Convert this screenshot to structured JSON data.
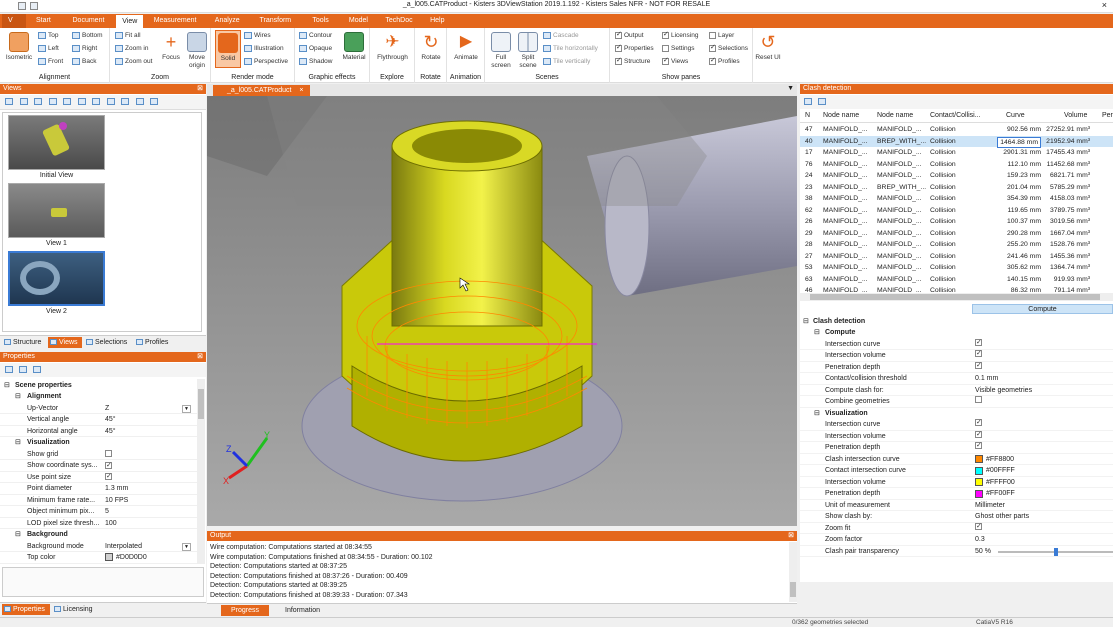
{
  "window": {
    "title": "_a_l005.CATProduct - Kisters 3DViewStation 2019.1.192 - Kisters Sales NFR - NOT FOR RESALE",
    "close_glyph": "×"
  },
  "menu": {
    "app_button": "V",
    "items": [
      "Start",
      "Document",
      "View",
      "Measurement",
      "Analyze",
      "Transform",
      "Tools",
      "Model",
      "TechDoc",
      "Help"
    ],
    "active": "View"
  },
  "ribbon": {
    "alignment": {
      "label": "Alignment",
      "isometric": "Isometric",
      "top": "Top",
      "bottom": "Bottom",
      "left": "Left",
      "right": "Right",
      "front": "Front",
      "back": "Back"
    },
    "zoom": {
      "label": "Zoom",
      "fit_all": "Fit all",
      "zoom_in": "Zoom in",
      "zoom_out": "Zoom out",
      "focus": "Focus",
      "move_origin": "Move origin"
    },
    "render_mode": {
      "label": "Render mode",
      "solid": "Solid",
      "wires": "Wires",
      "illustration": "Illustration",
      "perspective": "Perspective"
    },
    "graphic_effects": {
      "label": "Graphic effects",
      "contour": "Contour",
      "opaque": "Opaque",
      "shadow": "Shadow",
      "material": "Material"
    },
    "explore": {
      "label": "Explore",
      "flythrough": "Flythrough"
    },
    "rotate": {
      "label": "Rotate",
      "rotate": "Rotate"
    },
    "animation": {
      "label": "Animation",
      "animate": "Animate"
    },
    "scenes": {
      "label": "Scenes",
      "full_screen": "Full screen",
      "split_scene": "Split scene",
      "cascade": "Cascade",
      "tile_h": "Tile horizontally",
      "tile_v": "Tile vertically"
    },
    "show_panes": {
      "label": "Show panes",
      "items": [
        {
          "label": "Output",
          "checked": true
        },
        {
          "label": "Properties",
          "checked": true
        },
        {
          "label": "Structure",
          "checked": true
        },
        {
          "label": "Licensing",
          "checked": true
        },
        {
          "label": "Settings",
          "checked": false
        },
        {
          "label": "Views",
          "checked": true
        },
        {
          "label": "Layer",
          "checked": false
        },
        {
          "label": "Selections",
          "checked": true
        },
        {
          "label": "Profiles",
          "checked": true
        }
      ]
    },
    "reset_ui": "Reset UI"
  },
  "views_panel": {
    "title": "Views",
    "thumbnails": [
      "Initial View",
      "View 1",
      "View 2"
    ],
    "tabs": [
      "Structure",
      "Views",
      "Selections",
      "Profiles"
    ],
    "active_tab": "Views"
  },
  "properties_panel": {
    "title": "Properties",
    "section": "Scene properties",
    "rows": [
      {
        "type": "cat",
        "key": "Alignment"
      },
      {
        "type": "row",
        "key": "Up-Vector",
        "value": "Z"
      },
      {
        "type": "row",
        "key": "Vertical angle",
        "value": "45°"
      },
      {
        "type": "row",
        "key": "Horizontal angle",
        "value": "45°"
      },
      {
        "type": "cat",
        "key": "Visualization"
      },
      {
        "type": "check",
        "key": "Show grid",
        "checked": false
      },
      {
        "type": "check",
        "key": "Show coordinate sys...",
        "checked": true
      },
      {
        "type": "check",
        "key": "Use point size",
        "checked": true
      },
      {
        "type": "row",
        "key": "Point diameter",
        "value": "1.3 mm"
      },
      {
        "type": "row",
        "key": "Minimum frame rate...",
        "value": "10 FPS"
      },
      {
        "type": "row",
        "key": "Object minimum pix...",
        "value": "5"
      },
      {
        "type": "row",
        "key": "LOD pixel size thresh...",
        "value": "100"
      },
      {
        "type": "cat",
        "key": "Background"
      },
      {
        "type": "row",
        "key": "Background mode",
        "value": "Interpolated"
      },
      {
        "type": "color",
        "key": "Top color",
        "value": "#D0D0D0"
      }
    ],
    "tabs": [
      "Properties",
      "Licensing"
    ],
    "active_tab": "Properties"
  },
  "document_tab": {
    "label": "_a_l005.CATProduct",
    "close": "×"
  },
  "colors": {
    "accent": "#e4671c",
    "clash_curve": "#FF8800",
    "contact_curve": "#00FFFF",
    "volume": "#FFFF00",
    "depth": "#FF00FF"
  },
  "output_panel": {
    "title": "Output",
    "lines": [
      "Wire computation: Computations started at 08:34:55",
      "Wire computation: Computations finished at 08:34:55 - Duration: 00.102",
      "Detection: Computations started at 08:37:25",
      "Detection: Computations finished at 08:37:26 - Duration: 00.409",
      "Detection: Computations started at 08:39:25",
      "Detection: Computations finished at 08:39:33 - Duration: 07.343"
    ],
    "tabs": [
      "Progress",
      "Information"
    ],
    "active_tab": "Progress"
  },
  "clash_panel": {
    "title": "Clash detection",
    "headers": [
      "N",
      "Node name",
      "Node name",
      "Contact/Collisi...",
      "Curve",
      "Volume",
      "Per"
    ],
    "rows": [
      [
        "47",
        "MANIFOLD_...",
        "MANIFOLD_...",
        "Collision",
        "902.56 mm",
        "27252.91 mm³"
      ],
      [
        "40",
        "MANIFOLD_...",
        "BREP_WITH_...",
        "Collision",
        "1464.88 mm",
        "21952.94 mm³"
      ],
      [
        "17",
        "MANIFOLD_...",
        "MANIFOLD_...",
        "Collision",
        "2901.31 mm",
        "17455.43 mm³"
      ],
      [
        "76",
        "MANIFOLD_...",
        "MANIFOLD_...",
        "Collision",
        "112.10 mm",
        "11452.68 mm³"
      ],
      [
        "24",
        "MANIFOLD_...",
        "MANIFOLD_...",
        "Collision",
        "159.23 mm",
        "6821.71 mm³"
      ],
      [
        "23",
        "MANIFOLD_...",
        "BREP_WITH_...",
        "Collision",
        "201.04 mm",
        "5785.29 mm³"
      ],
      [
        "38",
        "MANIFOLD_...",
        "MANIFOLD_...",
        "Collision",
        "354.39 mm",
        "4158.03 mm³"
      ],
      [
        "62",
        "MANIFOLD_...",
        "MANIFOLD_...",
        "Collision",
        "119.65 mm",
        "3789.75 mm³"
      ],
      [
        "26",
        "MANIFOLD_...",
        "MANIFOLD_...",
        "Collision",
        "100.37 mm",
        "3019.56 mm³"
      ],
      [
        "29",
        "MANIFOLD_...",
        "MANIFOLD_...",
        "Collision",
        "290.28 mm",
        "1667.04 mm³"
      ],
      [
        "28",
        "MANIFOLD_...",
        "MANIFOLD_...",
        "Collision",
        "255.20 mm",
        "1528.76 mm³"
      ],
      [
        "27",
        "MANIFOLD_...",
        "MANIFOLD_...",
        "Collision",
        "241.46 mm",
        "1455.36 mm³"
      ],
      [
        "53",
        "MANIFOLD_...",
        "MANIFOLD_...",
        "Collision",
        "305.62 mm",
        "1364.74 mm³"
      ],
      [
        "63",
        "MANIFOLD_...",
        "MANIFOLD_...",
        "Collision",
        "140.15 mm",
        "919.93 mm³"
      ],
      [
        "46",
        "MANIFOLD_...",
        "MANIFOLD_...",
        "Collision",
        "86.32 mm",
        "791.14 mm³"
      ]
    ],
    "selected_row": 1
  },
  "clash_props": {
    "compute_button": "Compute",
    "section": "Clash detection",
    "rows": [
      {
        "type": "cat",
        "key": "Compute"
      },
      {
        "type": "check",
        "key": "Intersection curve",
        "checked": true
      },
      {
        "type": "check",
        "key": "Intersection volume",
        "checked": true
      },
      {
        "type": "check",
        "key": "Penetration depth",
        "checked": true
      },
      {
        "type": "row",
        "key": "Contact/collision threshold",
        "value": "0.1 mm"
      },
      {
        "type": "row",
        "key": "Compute clash for:",
        "value": "Visible geometries"
      },
      {
        "type": "check",
        "key": "Combine geometries",
        "checked": false
      },
      {
        "type": "cat",
        "key": "Visualization"
      },
      {
        "type": "check",
        "key": "Intersection curve",
        "checked": true
      },
      {
        "type": "check",
        "key": "Intersection volume",
        "checked": true
      },
      {
        "type": "check",
        "key": "Penetration depth",
        "checked": true
      },
      {
        "type": "color",
        "key": "Clash intersection curve",
        "value": "#FF8800"
      },
      {
        "type": "color",
        "key": "Contact intersection curve",
        "value": "#00FFFF"
      },
      {
        "type": "color",
        "key": "Intersection volume",
        "value": "#FFFF00"
      },
      {
        "type": "color",
        "key": "Penetration depth",
        "value": "#FF00FF"
      },
      {
        "type": "row",
        "key": "Unit of measurement",
        "value": "Millimeter"
      },
      {
        "type": "row",
        "key": "Show clash by:",
        "value": "Ghost other parts"
      },
      {
        "type": "check",
        "key": "Zoom fit",
        "checked": true
      },
      {
        "type": "row",
        "key": "Zoom factor",
        "value": "0.3"
      },
      {
        "type": "slider",
        "key": "Clash pair transparency",
        "value": "50 %",
        "level": 0.5
      }
    ]
  },
  "status": {
    "left": "0/362 geometries selected",
    "right": "CatiaV5 R16"
  },
  "axes": {
    "x": "X",
    "y": "Y",
    "z": "Z"
  }
}
